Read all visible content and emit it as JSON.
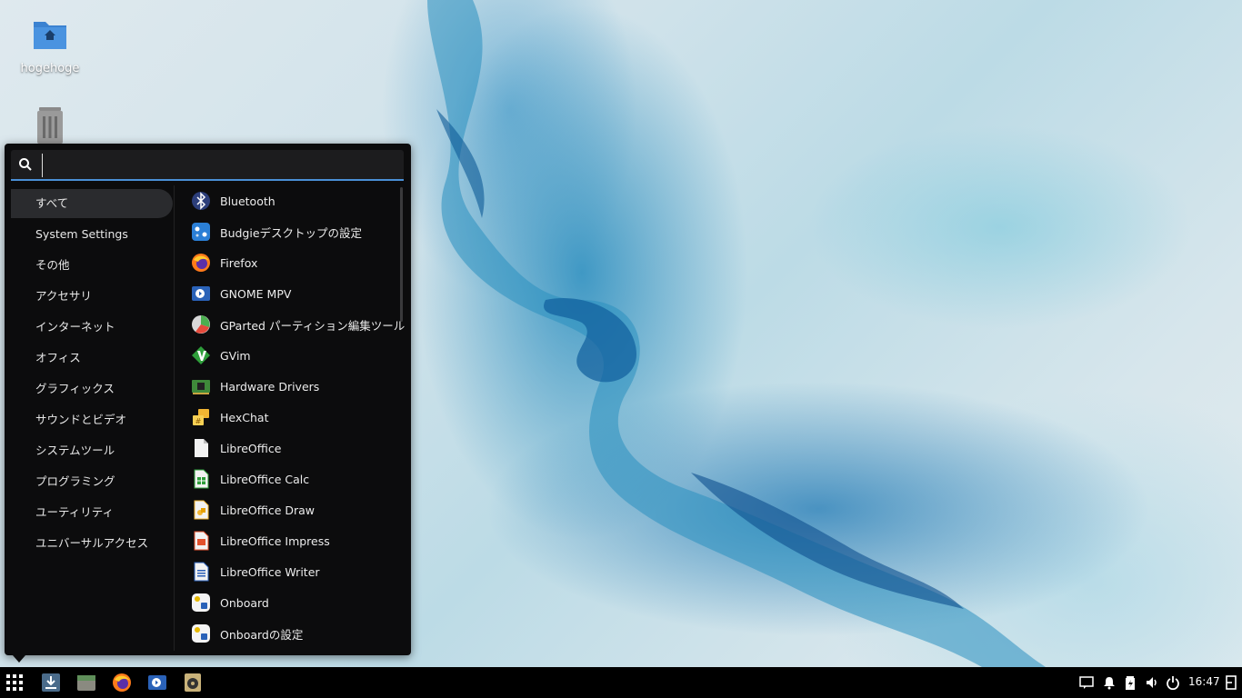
{
  "desktop": {
    "icons": [
      {
        "label": "hogehoge",
        "icon": "home-folder-icon"
      },
      {
        "label": "",
        "icon": "trash-icon"
      }
    ]
  },
  "menu": {
    "search": {
      "value": "",
      "placeholder": ""
    },
    "categories": [
      {
        "label": "すべて",
        "active": true
      },
      {
        "label": "System Settings"
      },
      {
        "label": "その他"
      },
      {
        "label": "アクセサリ"
      },
      {
        "label": "インターネット"
      },
      {
        "label": "オフィス"
      },
      {
        "label": "グラフィックス"
      },
      {
        "label": "サウンドとビデオ"
      },
      {
        "label": "システムツール"
      },
      {
        "label": "プログラミング"
      },
      {
        "label": "ユーティリティ"
      },
      {
        "label": "ユニバーサルアクセス"
      }
    ],
    "apps": [
      {
        "label": "Bluetooth",
        "icon": "bluetooth-icon"
      },
      {
        "label": "Budgieデスクトップの設定",
        "icon": "budgie-settings-icon"
      },
      {
        "label": "Firefox",
        "icon": "firefox-icon"
      },
      {
        "label": "GNOME MPV",
        "icon": "gnome-mpv-icon"
      },
      {
        "label": "GParted パーティション編集ツール",
        "icon": "gparted-icon"
      },
      {
        "label": "GVim",
        "icon": "gvim-icon"
      },
      {
        "label": "Hardware Drivers",
        "icon": "hardware-drivers-icon"
      },
      {
        "label": "HexChat",
        "icon": "hexchat-icon"
      },
      {
        "label": "LibreOffice",
        "icon": "libreoffice-icon"
      },
      {
        "label": "LibreOffice Calc",
        "icon": "libreoffice-calc-icon"
      },
      {
        "label": "LibreOffice Draw",
        "icon": "libreoffice-draw-icon"
      },
      {
        "label": "LibreOffice Impress",
        "icon": "libreoffice-impress-icon"
      },
      {
        "label": "LibreOffice Writer",
        "icon": "libreoffice-writer-icon"
      },
      {
        "label": "Onboard",
        "icon": "onboard-icon"
      },
      {
        "label": "Onboardの設定",
        "icon": "onboard-settings-icon"
      }
    ]
  },
  "taskbar": {
    "launchers": [
      "app-menu-icon",
      "downloads-icon",
      "files-icon",
      "firefox-icon",
      "gnome-mpv-icon",
      "rhythmbox-icon"
    ],
    "tray": [
      "notifications-area-icon",
      "bell-icon",
      "battery-icon",
      "volume-icon",
      "power-icon"
    ],
    "clock": "16:47",
    "end_icon": "raven-toggle-icon"
  },
  "colors": {
    "accent": "#4a8fd6",
    "menu_bg": "#0c0c0d",
    "active_category": "#2a2b2e"
  }
}
